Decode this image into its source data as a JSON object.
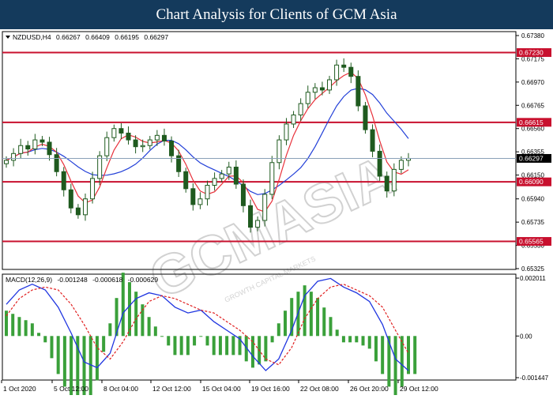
{
  "banner": {
    "title": "Chart Analysis for Clients of GCM Asia"
  },
  "watermark": {
    "text": "GCMASIA",
    "subtext": "GROWTH CAPITAL MARKETS"
  },
  "price_panel": {
    "info": {
      "symbol": "NZDUSD,H4",
      "open": "0.66267",
      "high": "0.66409",
      "low": "0.66195",
      "close": "0.66297"
    },
    "ticks": [
      "0.67380",
      "0.67175",
      "0.66970",
      "0.66765",
      "0.66560",
      "0.66355",
      "0.66150",
      "0.65940",
      "0.65735",
      "0.65530",
      "0.65325"
    ],
    "levels": [
      {
        "label": "0.67230",
        "value": 0.6723
      },
      {
        "label": "0.66615",
        "value": 0.66615
      },
      {
        "label": "0.66090",
        "value": 0.6609
      },
      {
        "label": "0.65565",
        "value": 0.65565
      }
    ],
    "current": {
      "label": "0.66297",
      "value": 0.66297
    }
  },
  "macd_panel": {
    "info": {
      "name": "MACD(12,26,9)",
      "main": "-0.001248",
      "signal": "-0.000618",
      "hist": "-0.000629"
    },
    "ticks": [
      "0.002011",
      "0.00",
      "-0.001447"
    ]
  },
  "xaxis": {
    "labels": [
      "1 Oct 2020",
      "5 Oct 12:00",
      "8 Oct 04:00",
      "12 Oct 12:00",
      "15 Oct 04:00",
      "19 Oct 16:00",
      "22 Oct 08:00",
      "26 Oct 20:00",
      "29 Oct 12:00"
    ]
  },
  "colors": {
    "banner": "#143a5c",
    "level_line": "#c8102e",
    "ma_fast": "#e8303a",
    "ma_slow": "#2340d8",
    "candle": "#1f5a1f",
    "macd_main": "#1f35e0",
    "macd_signal": "#e02020",
    "macd_hist": "#3aa03a"
  },
  "chart_data": [
    {
      "type": "candlestick",
      "title": "NZDUSD,H4",
      "ylim": [
        0.65325,
        0.6738
      ],
      "x": [
        "1 Oct 2020",
        "5 Oct 12:00",
        "8 Oct 04:00",
        "12 Oct 12:00",
        "15 Oct 04:00",
        "19 Oct 16:00",
        "22 Oct 08:00",
        "26 Oct 20:00",
        "29 Oct 12:00"
      ],
      "series": [
        {
          "name": "close",
          "values": [
            0.6628,
            0.6634,
            0.6641,
            0.6638,
            0.6646,
            0.6644,
            0.6633,
            0.6618,
            0.6602,
            0.6586,
            0.658,
            0.6594,
            0.6612,
            0.6632,
            0.6648,
            0.6656,
            0.6652,
            0.6646,
            0.664,
            0.6641,
            0.6646,
            0.665,
            0.6645,
            0.6632,
            0.6618,
            0.6603,
            0.6589,
            0.6594,
            0.6606,
            0.6612,
            0.6616,
            0.6622,
            0.6607,
            0.6588,
            0.6569,
            0.6575,
            0.6598,
            0.6626,
            0.6646,
            0.666,
            0.6668,
            0.6678,
            0.6688,
            0.6692,
            0.669,
            0.6699,
            0.6712,
            0.671,
            0.6702,
            0.6676,
            0.6655,
            0.6636,
            0.6614,
            0.6601,
            0.662,
            0.6628,
            0.66297
          ]
        }
      ]
    },
    {
      "type": "line",
      "title": "MACD(12,26,9)",
      "ylim": [
        -0.001447,
        0.002011
      ],
      "series": [
        {
          "name": "main",
          "values": [
            0.0011,
            0.0016,
            0.0018,
            0.0016,
            0.001,
            0.0001,
            -0.0009,
            -0.0011,
            -0.0006,
            0.0008,
            0.0013,
            0.0015,
            0.0014,
            0.001,
            0.0008,
            0.0009,
            0.0005,
            0.0002,
            -0.0001,
            -0.0007,
            -0.0012,
            -0.0008,
            0.0002,
            0.0014,
            0.0019,
            0.002,
            0.0017,
            0.0015,
            0.0012,
            0.0004,
            -0.0008,
            -0.0012
          ]
        },
        {
          "name": "signal",
          "values": [
            0.0007,
            0.0013,
            0.0016,
            0.0017,
            0.0016,
            0.0011,
            0.0004,
            -0.0004,
            -0.0008,
            -0.0002,
            0.0006,
            0.0012,
            0.0014,
            0.0013,
            0.0011,
            0.0009,
            0.0008,
            0.0005,
            0.0002,
            -0.0002,
            -0.0008,
            -0.001,
            -0.0004,
            0.0006,
            0.0013,
            0.0017,
            0.0018,
            0.0016,
            0.0014,
            0.001,
            0.0002,
            -0.0006
          ]
        }
      ]
    }
  ]
}
